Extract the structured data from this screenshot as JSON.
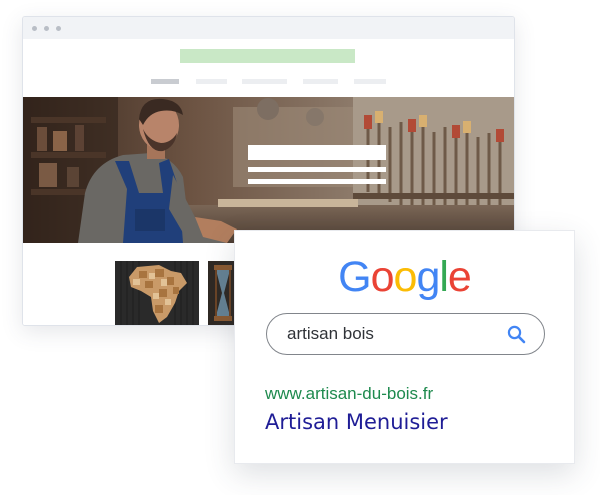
{
  "google": {
    "logo_letters": [
      {
        "char": "G",
        "color": "#4285F4"
      },
      {
        "char": "o",
        "color": "#EA4335"
      },
      {
        "char": "o",
        "color": "#FBBC05"
      },
      {
        "char": "g",
        "color": "#4285F4"
      },
      {
        "char": "l",
        "color": "#34A853"
      },
      {
        "char": "e",
        "color": "#EA4335"
      }
    ],
    "search_query": "artisan bois",
    "search_icon_color": "#4285F4"
  },
  "result": {
    "url": "www.artisan-du-bois.fr",
    "title": "Artisan Menuisier",
    "url_color": "#1e8a4e",
    "title_color": "#1f1d96"
  },
  "browser": {
    "logo_color": "#c9e8c6",
    "hero_image": "woodworker-in-workshop",
    "gallery_images": [
      "wooden-africa-map",
      "wooden-hourglass"
    ]
  }
}
